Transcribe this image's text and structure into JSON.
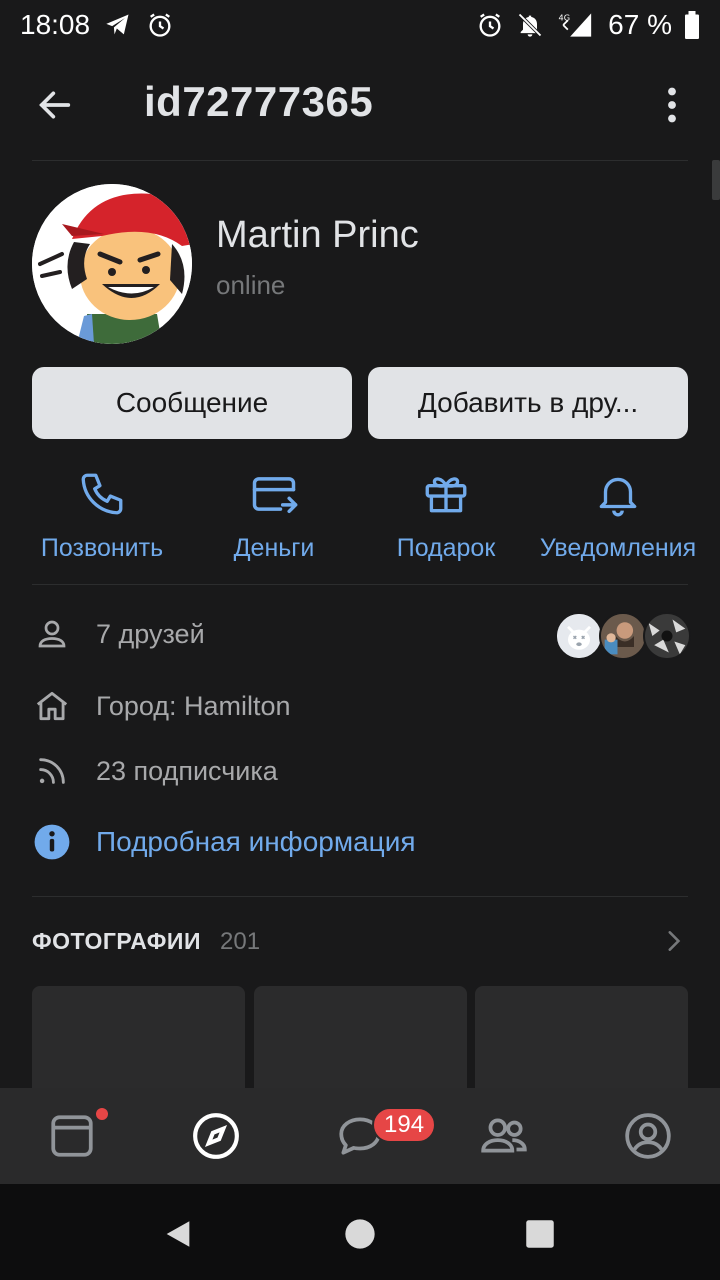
{
  "status_bar": {
    "time": "18:08",
    "battery": "67 %",
    "network": "4G"
  },
  "header": {
    "title": "id72777365"
  },
  "profile": {
    "name": "Martin Princ",
    "status": "online"
  },
  "buttons": {
    "message": "Сообщение",
    "add_friend": "Добавить в дру..."
  },
  "actions": [
    {
      "label": "Позвонить",
      "icon": "phone-icon"
    },
    {
      "label": "Деньги",
      "icon": "money-transfer-icon"
    },
    {
      "label": "Подарок",
      "icon": "gift-icon"
    },
    {
      "label": "Уведомления",
      "icon": "bell-icon"
    }
  ],
  "info": {
    "friends": "7 друзей",
    "city": "Город: Hamilton",
    "followers": "23 подписчика",
    "details": "Подробная информация"
  },
  "photos": {
    "title": "ФОТОГРАФИИ",
    "count": "201"
  },
  "tabbar": {
    "messages_badge": "194"
  },
  "colors": {
    "background": "#19191a",
    "accent": "#71aaeb",
    "button_bg": "#e1e3e6",
    "badge": "#e64646",
    "tabbar_bg": "#2a2a2b"
  }
}
